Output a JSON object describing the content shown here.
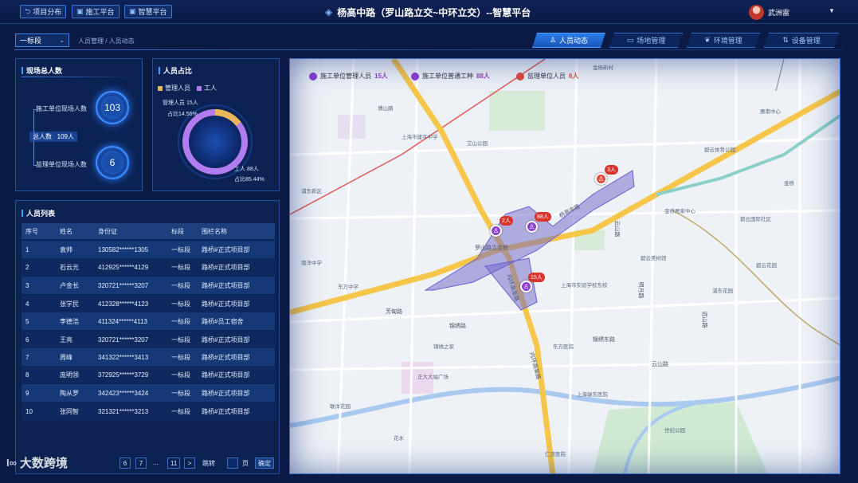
{
  "header": {
    "nav_buttons": [
      {
        "label": "项目分布",
        "icon": "back-arrow-icon"
      },
      {
        "label": "施工平台",
        "icon": "image-icon"
      },
      {
        "label": "智慧平台",
        "icon": "image-icon"
      }
    ],
    "title": "杨高中路（罗山路立交~中环立交）--智慧平台",
    "user_name": "武洲雷"
  },
  "subheader": {
    "section_select": "一标段",
    "breadcrumb": "人员管理 / 人员动态",
    "tabs": [
      {
        "label": "人员动态",
        "icon": "person-icon",
        "active": true
      },
      {
        "label": "场地管理",
        "icon": "site-icon",
        "active": false
      },
      {
        "label": "环境管理",
        "icon": "leaf-icon",
        "active": false
      },
      {
        "label": "设备管理",
        "icon": "device-icon",
        "active": false
      }
    ]
  },
  "onsite_panel": {
    "title": "现场总人数",
    "construction_label": "施工单位现场人数",
    "construction_count": "103",
    "total_label": "总人数",
    "total_count": "109人",
    "supervision_label": "监理单位现场人数",
    "supervision_count": "6"
  },
  "ratio_panel": {
    "title": "人员占比",
    "legend": [
      {
        "label": "管理人员",
        "color": "#e9b65a"
      },
      {
        "label": "工人",
        "color": "#b07cf0"
      }
    ],
    "management_label": "管理人员 15人",
    "management_pct_label": "占比14.56%",
    "worker_label": "工人 88人",
    "worker_pct_label": "占比85.44%",
    "management_fraction": 0.1456
  },
  "people_list": {
    "title": "人员列表",
    "columns": [
      "序号",
      "姓名",
      "身份证",
      "标段",
      "围栏名称"
    ],
    "rows": [
      [
        "1",
        "袁帅",
        "130582******1305",
        "一标段",
        "路桥#正式项目部"
      ],
      [
        "2",
        "石云光",
        "412925******4129",
        "一标段",
        "路桥#正式项目部"
      ],
      [
        "3",
        "卢金长",
        "320721******3207",
        "一标段",
        "路桥#正式项目部"
      ],
      [
        "4",
        "张学民",
        "412328******4123",
        "一标段",
        "路桥#正式项目部"
      ],
      [
        "5",
        "李德浩",
        "411324******4113",
        "一标段",
        "路桥#员工宿舍"
      ],
      [
        "6",
        "王亮",
        "320721******3207",
        "一标段",
        "路桥#正式项目部"
      ],
      [
        "7",
        "周峰",
        "341322******3413",
        "一标段",
        "路桥#正式项目部"
      ],
      [
        "8",
        "庞明领",
        "372925******3729",
        "一标段",
        "路桥#正式项目部"
      ],
      [
        "9",
        "陶从罗",
        "342423******3424",
        "一标段",
        "路桥#正式项目部"
      ],
      [
        "10",
        "张同智",
        "321321******3213",
        "一标段",
        "路桥#正式项目部"
      ]
    ],
    "pagination": {
      "pages": [
        "6",
        "7",
        "...",
        "11"
      ],
      "next": ">",
      "jump_label": "跳转",
      "jump_suffix": "页",
      "confirm": "确定"
    }
  },
  "map": {
    "legend": [
      {
        "label": "施工单位管理人员",
        "count": "15人",
        "color": "#8e3fd4"
      },
      {
        "label": "施工单位普通工种",
        "count": "88人",
        "color": "#8e3fd4"
      },
      {
        "label": "监理单位人员",
        "count": "6人",
        "color": "#e14a3b"
      }
    ],
    "pins": [
      {
        "badge": "3人",
        "color": "red"
      },
      {
        "badge": "2人",
        "color": "purple"
      },
      {
        "badge": "88人",
        "color": "purple"
      },
      {
        "badge": "15人",
        "color": "purple"
      }
    ],
    "road_labels": [
      "杨高中路",
      "罗山路立交桥",
      "内环高架路",
      "内环高架路",
      "云山路",
      "明月路",
      "芳甸路",
      "锦绣东路",
      "云山路",
      "锦绣路",
      "远山路"
    ],
    "place_labels": [
      "博山路",
      "浦东新区",
      "上海市建平中学",
      "艾山公园",
      "金杨新村",
      "碧云体育公园",
      "金桥居家中心",
      "碧云国际社区",
      "碧云美树馆",
      "上海市实验学校东校",
      "东方中学",
      "浦东花园",
      "南洋中学",
      "东方医院",
      "锦绣之家",
      "上海瑞东医院",
      "世纪公园",
      "花木",
      "仁济医院",
      "正大大福广场",
      "碧云花园",
      "联洋花园",
      "金桥",
      "惠南中心"
    ]
  },
  "brand": {
    "logo_text": "大数跨境",
    "mark": "I∞"
  }
}
